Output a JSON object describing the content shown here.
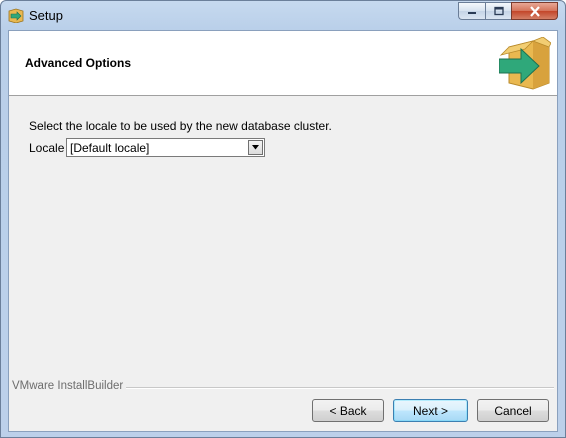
{
  "window": {
    "title": "Setup",
    "app_icon": "installer-box-icon",
    "caption_buttons": [
      "minimize-icon",
      "maximize-icon",
      "close-icon"
    ]
  },
  "header": {
    "title": "Advanced Options",
    "logo": "box-arrow-icon"
  },
  "main": {
    "prompt": "Select the locale to be used by the new database cluster.",
    "locale_label": "Locale",
    "locale_value": "[Default locale]"
  },
  "footer": {
    "brand": "VMware InstallBuilder",
    "back_label": "< Back",
    "next_label": "Next >",
    "cancel_label": "Cancel"
  },
  "colors": {
    "title_bar": "#bcd0ea",
    "close_button": "#c3462a",
    "client_bg": "#f0f0f0",
    "logo_arrow": "#2fa87a",
    "logo_box": "#e9b850"
  }
}
